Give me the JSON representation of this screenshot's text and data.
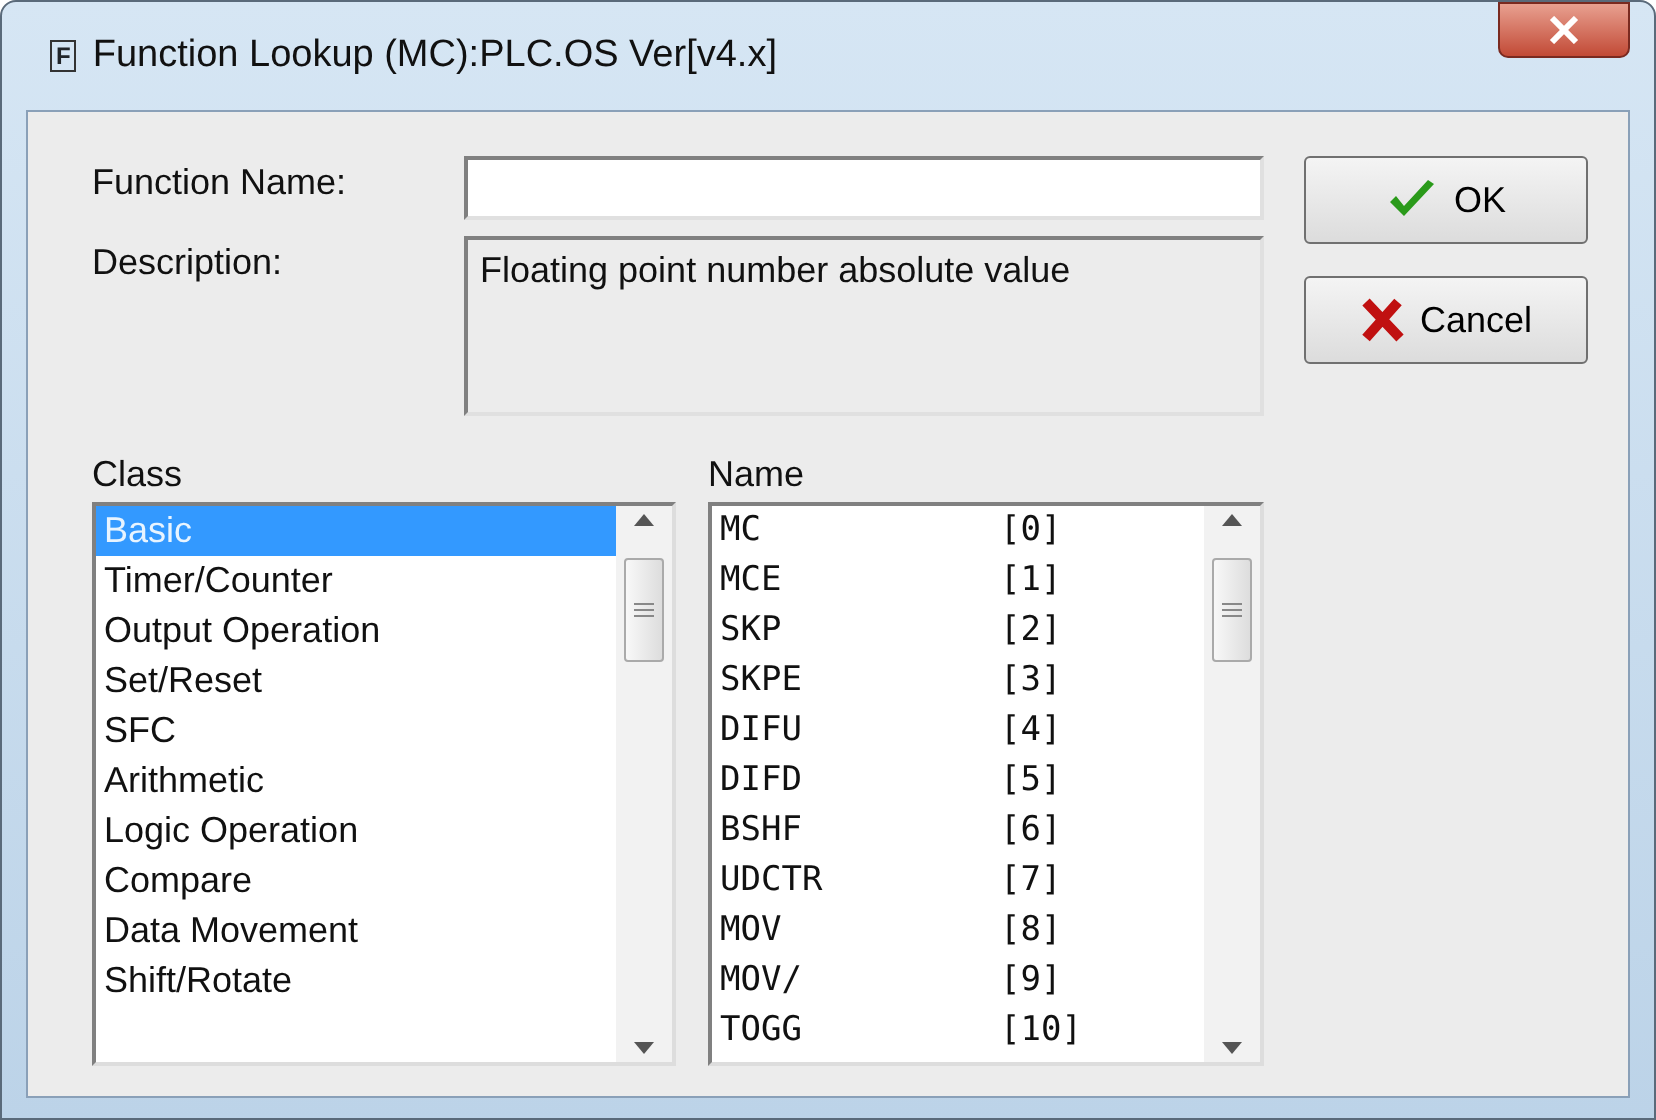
{
  "window": {
    "icon_text": "F",
    "title": "Function Lookup (MC):PLC.OS Ver[v4.x]"
  },
  "function_name": {
    "label": "Function Name:"
  },
  "description": {
    "label": "Description:",
    "value": "Floating point number absolute value"
  },
  "buttons": [
    {
      "kind": "ok",
      "label": "OK"
    },
    {
      "kind": "cancel",
      "label": "Cancel"
    }
  ],
  "class_list": {
    "label": "Class",
    "items": [
      {
        "label": "Basic",
        "selected": true
      },
      {
        "label": "Timer/Counter",
        "selected": false
      },
      {
        "label": "Output Operation",
        "selected": false
      },
      {
        "label": "Set/Reset",
        "selected": false
      },
      {
        "label": "SFC",
        "selected": false
      },
      {
        "label": "Arithmetic",
        "selected": false
      },
      {
        "label": "Logic Operation",
        "selected": false
      },
      {
        "label": "Compare",
        "selected": false
      },
      {
        "label": "Data Movement",
        "selected": false
      },
      {
        "label": "Shift/Rotate",
        "selected": false
      }
    ]
  },
  "name_list": {
    "label": "Name",
    "items": [
      {
        "name": "MC",
        "number": "[0]",
        "selected": false
      },
      {
        "name": "MCE",
        "number": "[1]",
        "selected": false
      },
      {
        "name": "SKP",
        "number": "[2]",
        "selected": false
      },
      {
        "name": "SKPE",
        "number": "[3]",
        "selected": false
      },
      {
        "name": "DIFU",
        "number": "[4]",
        "selected": false
      },
      {
        "name": "DIFD",
        "number": "[5]",
        "selected": false
      },
      {
        "name": "BSHF",
        "number": "[6]",
        "selected": false
      },
      {
        "name": "UDCTR",
        "number": "[7]",
        "selected": false
      },
      {
        "name": "MOV",
        "number": "[8]",
        "selected": false
      },
      {
        "name": "MOV/",
        "number": "[9]",
        "selected": false
      },
      {
        "name": "TOGG",
        "number": "[10]",
        "selected": false
      }
    ]
  }
}
